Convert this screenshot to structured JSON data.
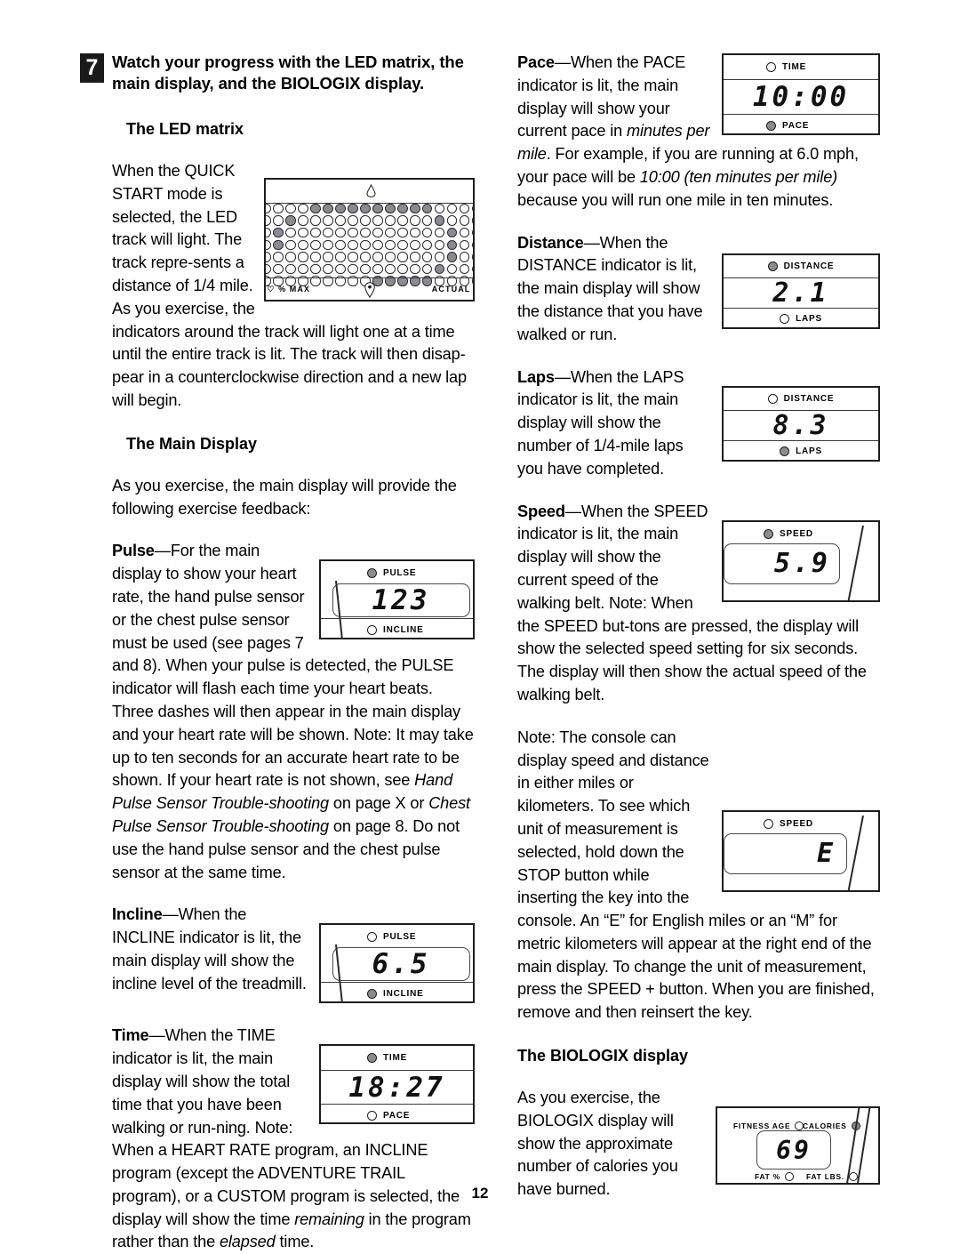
{
  "page": {
    "number": "12"
  },
  "step": {
    "number": "7",
    "title": "Watch your progress with the LED matrix,  the main display, and the BIOLOGIX display."
  },
  "left_column": {
    "heading_led_matrix": "The LED matrix",
    "para_led_1": "When the QUICK START mode is selected, the LED track will light. The track repre-sents a distance of 1/4 mile. As you exercise, the indicators around the track will light one at a time until the entire track is lit. The track will then disap-pear in a counterclockwise direction and a new lap will begin.",
    "heading_main_display": "The Main Display",
    "para_main_display": "As you exercise, the main display will provide the following exercise feedback:",
    "pulse": {
      "term": "Pulse",
      "dash": "—",
      "text_a": "For the main display to show your heart rate, the hand pulse sensor or the chest pulse sensor must be used (see pages 7 and 8). When your pulse is detected, the PULSE indicator will flash each time your heart beats. Three dashes will then appear in the main display and your heart rate will be shown. Note: It may take up to ten seconds for an accurate heart rate to be shown. If your heart rate is not shown, see ",
      "italic_a": "Hand Pulse Sensor Trouble-shooting",
      "text_b": " on page X or ",
      "italic_b": "Chest Pulse Sensor Trouble-shooting",
      "text_c": " on page 8. Do not use the hand pulse sensor and the chest pulse sensor at the same time."
    },
    "incline": {
      "term": "Incline",
      "dash": "—",
      "text": "When the INCLINE indicator is lit, the main display will show the incline level of the treadmill."
    },
    "time": {
      "term": "Time",
      "dash": "—",
      "text_a": "When the TIME indicator is lit, the main display will show the total time that you have been walking or run-ning. Note: When a HEART RATE program, an INCLINE program (except the ADVENTURE TRAIL program), or a CUSTOM program is selected, the display will show the time ",
      "italic_a": "remaining",
      "text_b": " in the program rather than the ",
      "italic_b": "elapsed",
      "text_c": " time."
    }
  },
  "right_column": {
    "pace": {
      "term": "Pace",
      "dash": "—",
      "text_a": "When the PACE indicator is lit, the main display will show your current pace in ",
      "italic_a": "minutes per mile",
      "text_b": ". For example, if you are running at 6.0 mph, your pace will be ",
      "italic_b": "10:00 (ten minutes per mile)",
      "text_c": " because you will run one mile in ten minutes."
    },
    "distance": {
      "term": "Distance",
      "dash": "—",
      "text": "When the DISTANCE indicator is lit, the main display will show the distance that you have walked or run."
    },
    "laps": {
      "term": "Laps",
      "dash": "—",
      "text": "When the LAPS indicator is lit, the main display will show the number of 1/4-mile laps you have completed."
    },
    "speed": {
      "term": "Speed",
      "dash": "—",
      "text": "When the SPEED indicator is lit, the main display will show the current speed of the walking belt. Note: When the SPEED but-tons are pressed, the display will show the selected speed setting for six seconds. The display will then show the actual speed of the walking belt."
    },
    "note_units": "Note: The console can display speed and distance in either miles or kilometers. To see which unit of measurement is selected, hold down the STOP button while inserting the key into the console. An “E” for English miles or an “M” for metric kilometers will appear at the right end of the main display. To change the unit of measurement, press the SPEED + button. When you are finished, remove and then reinsert the key.",
    "heading_biologix": "The BIOLOGIX display",
    "para_biologix": "As you exercise, the BIOLOGIX display will show the approximate number of calories you have burned."
  },
  "figures": {
    "led_matrix": {
      "label_left": "ET ♡ % MAX",
      "label_right": "ACTUAL ♡",
      "columns": 18,
      "rows": 7,
      "lit_cells": [
        [
          4,
          5,
          6,
          7,
          8,
          9,
          10,
          11,
          12,
          13
        ],
        [
          2,
          14
        ],
        [
          1,
          15
        ],
        [
          1,
          15
        ],
        [
          15
        ],
        [
          14
        ],
        [
          9,
          10,
          11,
          12,
          13
        ]
      ]
    },
    "pulse_display": {
      "top_label": "PULSE",
      "top_on": true,
      "bottom_label": "INCLINE",
      "bottom_on": false,
      "value": "123"
    },
    "incline_display": {
      "top_label": "PULSE",
      "top_on": false,
      "bottom_label": "INCLINE",
      "bottom_on": true,
      "value": "6.5"
    },
    "time_display": {
      "top_label": "TIME",
      "top_on": true,
      "bottom_label": "PACE",
      "bottom_on": false,
      "value": "18:27"
    },
    "pace_display": {
      "top_label": "TIME",
      "top_on": false,
      "bottom_label": "PACE",
      "bottom_on": true,
      "value": "10:00"
    },
    "distance_display": {
      "top_label": "DISTANCE",
      "top_on": true,
      "bottom_label": "LAPS",
      "bottom_on": false,
      "value": "2.1"
    },
    "laps_display": {
      "top_label": "DISTANCE",
      "top_on": false,
      "bottom_label": "LAPS",
      "bottom_on": true,
      "value": "8.3"
    },
    "speed_display": {
      "top_label": "SPEED",
      "top_on": true,
      "value": "5.9"
    },
    "units_display": {
      "top_label": "SPEED",
      "top_on": false,
      "value": "E"
    },
    "biologix_display": {
      "label_fitness_age": "FITNESS AGE",
      "fitness_age_on": false,
      "label_calories": "CALORIES",
      "calories_on": true,
      "label_fat_pct": "FAT %",
      "fat_pct_on": false,
      "label_fat_lbs": "FAT LBS.",
      "fat_lbs_on": false,
      "value": "69"
    }
  }
}
